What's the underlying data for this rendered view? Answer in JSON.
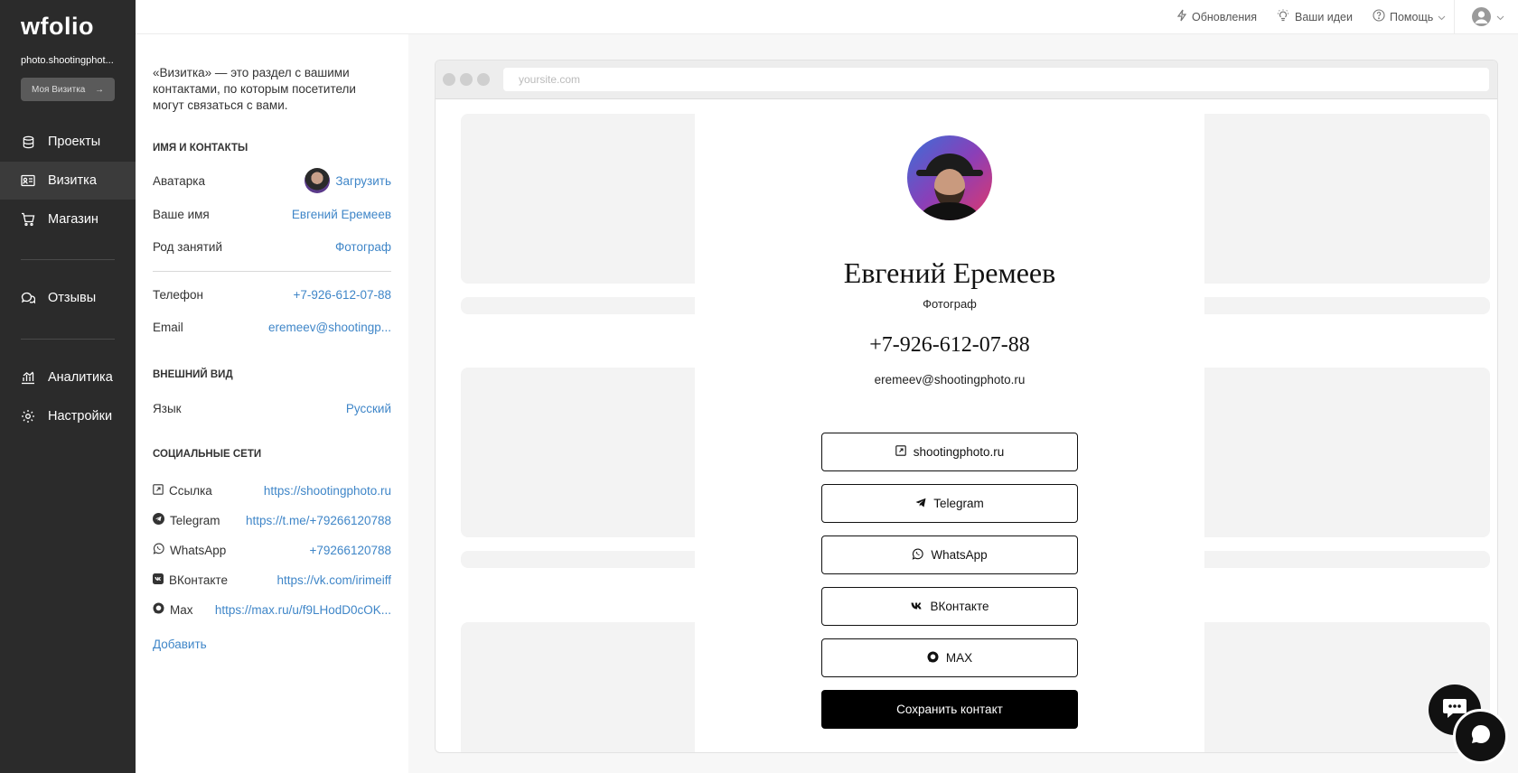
{
  "sidebar": {
    "logo": "wfolio",
    "site_name": "photo.shootingphot...",
    "my_card_button": "Моя Визитка",
    "items": [
      {
        "label": "Проекты",
        "icon": "database-icon"
      },
      {
        "label": "Визитка",
        "icon": "id-card-icon"
      },
      {
        "label": "Магазин",
        "icon": "cart-icon"
      },
      {
        "label": "Отзывы",
        "icon": "chat-bubbles-icon"
      },
      {
        "label": "Аналитика",
        "icon": "chart-icon"
      },
      {
        "label": "Настройки",
        "icon": "gear-icon"
      }
    ],
    "active_item": "Визитка"
  },
  "topbar": {
    "updates": "Обновления",
    "ideas": "Ваши идеи",
    "help": "Помощь"
  },
  "panel": {
    "intro": "«Визитка» — это раздел с вашими контактами, по которым посетители могут связаться с вами.",
    "section_contacts": "Имя и контакты",
    "avatar_label": "Аватарка",
    "avatar_action": "Загрузить",
    "name_label": "Ваше имя",
    "name_value": "Евгений Еремеев",
    "occupation_label": "Род занятий",
    "occupation_value": "Фотограф",
    "phone_label": "Телефон",
    "phone_value": "+7-926-612-07-88",
    "email_label": "Email",
    "email_value": "eremeev@shootingp...",
    "section_appearance": "Внешний вид",
    "language_label": "Язык",
    "language_value": "Русский",
    "section_social": "Социальные сети",
    "social": [
      {
        "label": "Ссылка",
        "value": "https://shootingphoto.ru",
        "icon": "external-link-icon"
      },
      {
        "label": "Telegram",
        "value": "https://t.me/+79266120788",
        "icon": "telegram-icon"
      },
      {
        "label": "WhatsApp",
        "value": "+79266120788",
        "icon": "whatsapp-icon"
      },
      {
        "label": "ВКонтакте",
        "value": "https://vk.com/irimeiff",
        "icon": "vk-icon"
      },
      {
        "label": "Max",
        "value": "https://max.ru/u/f9LHodD0cOK...",
        "icon": "max-icon"
      }
    ],
    "add_link": "Добавить"
  },
  "preview": {
    "url_placeholder": "yoursite.com",
    "name": "Евгений Еремеев",
    "role": "Фотограф",
    "phone": "+7-926-612-07-88",
    "email": "eremeev@shootingphoto.ru",
    "buttons": [
      {
        "label": "shootingphoto.ru",
        "icon": "external-link-icon"
      },
      {
        "label": "Telegram",
        "icon": "telegram-icon"
      },
      {
        "label": "WhatsApp",
        "icon": "whatsapp-icon"
      },
      {
        "label": "ВКонтакте",
        "icon": "vk-icon"
      },
      {
        "label": "MAX",
        "icon": "max-icon"
      }
    ],
    "save_button": "Сохранить контакт"
  }
}
